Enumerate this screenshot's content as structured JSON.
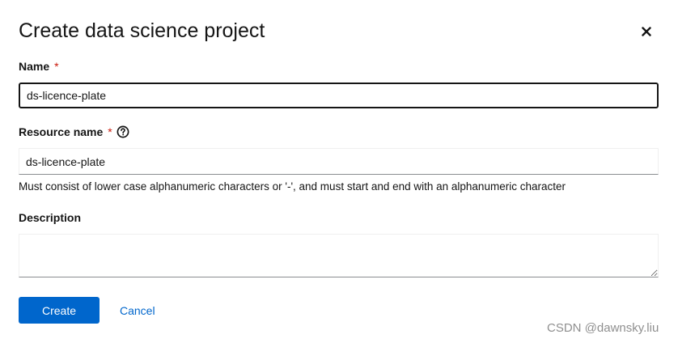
{
  "modal": {
    "title": "Create data science project",
    "close_icon": "close-icon"
  },
  "name_field": {
    "label": "Name",
    "required_marker": "*",
    "value": "ds-licence-plate"
  },
  "resource_name_field": {
    "label": "Resource name",
    "required_marker": "*",
    "help_icon": "question-circle-icon",
    "value": "ds-licence-plate",
    "helper_text": "Must consist of lower case alphanumeric characters or '-', and must start and end with an alphanumeric character"
  },
  "description_field": {
    "label": "Description",
    "value": ""
  },
  "actions": {
    "create_label": "Create",
    "cancel_label": "Cancel"
  },
  "colors": {
    "primary": "#0066cc",
    "required": "#c9190b",
    "text": "#151515"
  },
  "watermark": "CSDN @dawnsky.liu"
}
